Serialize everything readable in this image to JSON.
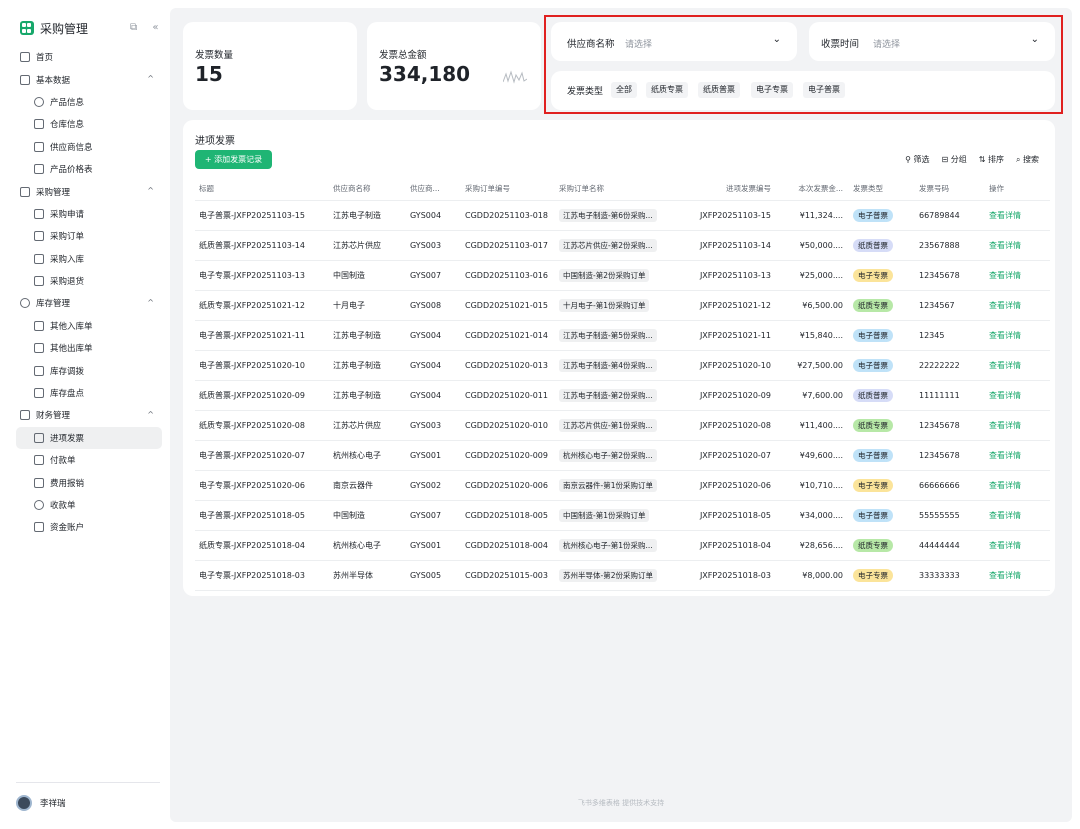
{
  "sidebar": {
    "title": "采购管理",
    "tools": "⧉ «",
    "nav": [
      {
        "label": "首页",
        "level": 0,
        "icon": "home-icon"
      },
      {
        "label": "基本数据",
        "level": 0,
        "icon": "layers-icon",
        "caret": "^"
      },
      {
        "label": "产品信息",
        "level": 1,
        "icon": "globe-icon"
      },
      {
        "label": "仓库信息",
        "level": 1,
        "icon": "warehouse-icon"
      },
      {
        "label": "供应商信息",
        "level": 1,
        "icon": "monitor-icon"
      },
      {
        "label": "产品价格表",
        "level": 1,
        "icon": "price-tag-icon"
      },
      {
        "label": "采购管理",
        "level": 0,
        "icon": "document-icon",
        "caret": "^"
      },
      {
        "label": "采购申请",
        "level": 1,
        "icon": "mail-icon"
      },
      {
        "label": "采购订单",
        "level": 1,
        "icon": "calendar-icon"
      },
      {
        "label": "采购入库",
        "level": 1,
        "icon": "inbound-icon"
      },
      {
        "label": "采购退货",
        "level": 1,
        "icon": "return-icon"
      },
      {
        "label": "库存管理",
        "level": 0,
        "icon": "clock-icon",
        "caret": "^"
      },
      {
        "label": "其他入库单",
        "level": 1,
        "icon": "inbox-icon"
      },
      {
        "label": "其他出库单",
        "level": 1,
        "icon": "outbox-icon"
      },
      {
        "label": "库存调拨",
        "level": 1,
        "icon": "transfer-icon"
      },
      {
        "label": "库存盘点",
        "level": 1,
        "icon": "gear-icon"
      },
      {
        "label": "财务管理",
        "level": 0,
        "icon": "copy-icon",
        "caret": "^"
      },
      {
        "label": "进项发票",
        "level": 1,
        "icon": "barcode-icon",
        "active": true
      },
      {
        "label": "付款单",
        "level": 1,
        "icon": "payment-icon"
      },
      {
        "label": "费用报销",
        "level": 1,
        "icon": "trophy-icon"
      },
      {
        "label": "收款单",
        "level": 1,
        "icon": "bulb-icon"
      },
      {
        "label": "资金账户",
        "level": 1,
        "icon": "bar-chart-icon"
      }
    ],
    "user": "李祥瑞"
  },
  "stats": {
    "count_label": "发票数量",
    "count_value": "15",
    "amount_label": "发票总金额",
    "amount_value": "334,180"
  },
  "filters": {
    "supplier_label": "供应商名称",
    "supplier_placeholder": "请选择",
    "receive_label": "收票时间",
    "receive_placeholder": "请选择",
    "type_label": "发票类型",
    "type_chips": [
      "全部",
      "纸质专票",
      "纸质普票",
      "电子专票",
      "电子普票"
    ]
  },
  "invoices": {
    "title": "进项发票",
    "add_button": "+ 添加发票记录",
    "toolbar": [
      "筛选",
      "分组",
      "排序",
      "搜索"
    ],
    "columns": [
      "标题",
      "供应商名称",
      "供应商...",
      "采购订单编号",
      "采购订单名称",
      "进项发票编号",
      "本次发票金...",
      "发票类型",
      "发票号码",
      "操作"
    ],
    "rows": [
      [
        "电子普票-JXFP20251103-15",
        "江苏电子制造",
        "GYS004",
        "CGDD20251103-018",
        "江苏电子制造-第6份采购...",
        "JXFP20251103-15",
        "¥11,324....",
        "电子普票",
        "66789844",
        "查看详情"
      ],
      [
        "纸质普票-JXFP20251103-14",
        "江苏芯片供应",
        "GYS003",
        "CGDD20251103-017",
        "江苏芯片供应-第2份采购...",
        "JXFP20251103-14",
        "¥50,000....",
        "纸质普票",
        "23567888",
        "查看详情"
      ],
      [
        "电子专票-JXFP20251103-13",
        "中国制造",
        "GYS007",
        "CGDD20251103-016",
        "中国制造-第2份采购订单",
        "JXFP20251103-13",
        "¥25,000....",
        "电子专票",
        "12345678",
        "查看详情"
      ],
      [
        "纸质专票-JXFP20251021-12",
        "十月电子",
        "GYS008",
        "CGDD20251021-015",
        "十月电子-第1份采购订单",
        "JXFP20251021-12",
        "¥6,500.00",
        "纸质专票",
        "1234567",
        "查看详情"
      ],
      [
        "电子普票-JXFP20251021-11",
        "江苏电子制造",
        "GYS004",
        "CGDD20251021-014",
        "江苏电子制造-第5份采购...",
        "JXFP20251021-11",
        "¥15,840....",
        "电子普票",
        "12345",
        "查看详情"
      ],
      [
        "电子普票-JXFP20251020-10",
        "江苏电子制造",
        "GYS004",
        "CGDD20251020-013",
        "江苏电子制造-第4份采购...",
        "JXFP20251020-10",
        "¥27,500.00",
        "电子普票",
        "22222222",
        "查看详情"
      ],
      [
        "纸质普票-JXFP20251020-09",
        "江苏电子制造",
        "GYS004",
        "CGDD20251020-011",
        "江苏电子制造-第2份采购...",
        "JXFP20251020-09",
        "¥7,600.00",
        "纸质普票",
        "11111111",
        "查看详情"
      ],
      [
        "纸质专票-JXFP20251020-08",
        "江苏芯片供应",
        "GYS003",
        "CGDD20251020-010",
        "江苏芯片供应-第1份采购...",
        "JXFP20251020-08",
        "¥11,400....",
        "纸质专票",
        "12345678",
        "查看详情"
      ],
      [
        "电子普票-JXFP20251020-07",
        "杭州核心电子",
        "GYS001",
        "CGDD20251020-009",
        "杭州核心电子-第2份采购...",
        "JXFP20251020-07",
        "¥49,600....",
        "电子普票",
        "12345678",
        "查看详情"
      ],
      [
        "电子专票-JXFP20251020-06",
        "南京云器件",
        "GYS002",
        "CGDD20251020-006",
        "南京云器件-第1份采购订单",
        "JXFP20251020-06",
        "¥10,710....",
        "电子专票",
        "66666666",
        "查看详情"
      ],
      [
        "电子普票-JXFP20251018-05",
        "中国制造",
        "GYS007",
        "CGDD20251018-005",
        "中国制造-第1份采购订单",
        "JXFP20251018-05",
        "¥34,000....",
        "电子普票",
        "55555555",
        "查看详情"
      ],
      [
        "纸质专票-JXFP20251018-04",
        "杭州核心电子",
        "GYS001",
        "CGDD20251018-004",
        "杭州核心电子-第1份采购...",
        "JXFP20251018-04",
        "¥28,656....",
        "纸质专票",
        "44444444",
        "查看详情"
      ],
      [
        "电子专票-JXFP20251018-03",
        "苏州半导体",
        "GYS005",
        "CGDD20251015-003",
        "苏州半导体-第2份采购订单",
        "JXFP20251018-03",
        "¥8,000.00",
        "电子专票",
        "33333333",
        "查看详情"
      ]
    ],
    "badge_colors": {
      "电子普票": "#bfe2f8",
      "纸质普票": "#d6dcf7",
      "电子专票": "#fbe49a",
      "纸质专票": "#b7e8a7"
    }
  },
  "footer": "飞书多维表格 提供技术支持",
  "colors": {
    "accent": "#1fb574",
    "highlight_border": "#e02020"
  }
}
